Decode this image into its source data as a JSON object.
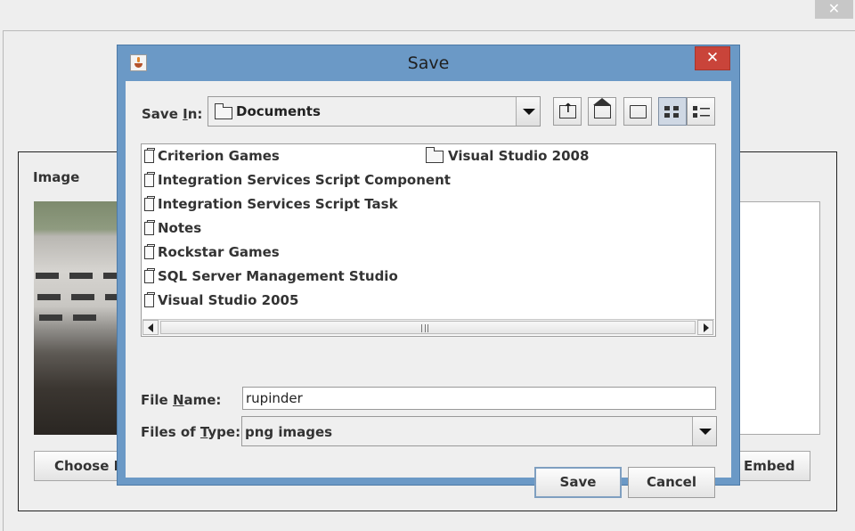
{
  "background_app": {
    "close_glyph": "✕",
    "image_label": "Image",
    "choose_button": "Choose Image",
    "embed_button": "Embed"
  },
  "dialog": {
    "title": "Save",
    "close_glyph": "✕",
    "save_in": {
      "label_prefix": "Save ",
      "label_mnemonic": "I",
      "label_suffix": "n:",
      "value": "Documents"
    },
    "toolbar": [
      "up-one-level",
      "home",
      "create-new-folder",
      "list-view",
      "details-view"
    ],
    "files": [
      {
        "name": "Criterion Games",
        "type": "folder"
      },
      {
        "name": "Integration Services Script Component",
        "type": "folder"
      },
      {
        "name": "Integration Services Script Task",
        "type": "folder"
      },
      {
        "name": "Notes",
        "type": "folder"
      },
      {
        "name": "Rockstar Games",
        "type": "folder"
      },
      {
        "name": "SQL Server Management Studio",
        "type": "folder"
      },
      {
        "name": "Visual Studio 2005",
        "type": "folder"
      },
      {
        "name": "Visual Studio 2008",
        "type": "folder"
      }
    ],
    "file_name": {
      "label_prefix": "File ",
      "label_mnemonic": "N",
      "label_suffix": "ame:",
      "value": "rupinder"
    },
    "files_of_type": {
      "label_prefix": "Files of ",
      "label_mnemonic": "T",
      "label_suffix": "ype:",
      "value": "png images"
    },
    "save_button": "Save",
    "cancel_button": "Cancel"
  },
  "colors": {
    "dialog_frame": "#6b99c6",
    "close_button": "#c9443a"
  }
}
